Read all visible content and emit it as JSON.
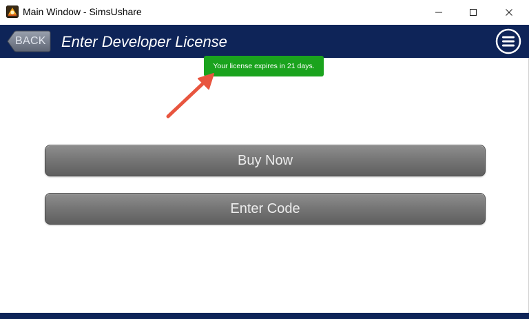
{
  "window": {
    "title": "Main Window - SimsUshare",
    "app_icon": "simsushare-logo-icon",
    "controls": [
      "minimize-icon",
      "maximize-icon",
      "close-icon"
    ]
  },
  "header": {
    "back_label": "BACK",
    "title": "Enter Developer License",
    "menu_icon": "hamburger-menu-icon"
  },
  "notification": {
    "text": "Your license expires in 21 days."
  },
  "actions": {
    "buy_now_label": "Buy Now",
    "enter_code_label": "Enter Code"
  },
  "colors": {
    "header_bg": "#0e2458",
    "notification_bg": "#1aa31d",
    "annotation_arrow": "#e8553f",
    "button_gray": "#777777"
  }
}
